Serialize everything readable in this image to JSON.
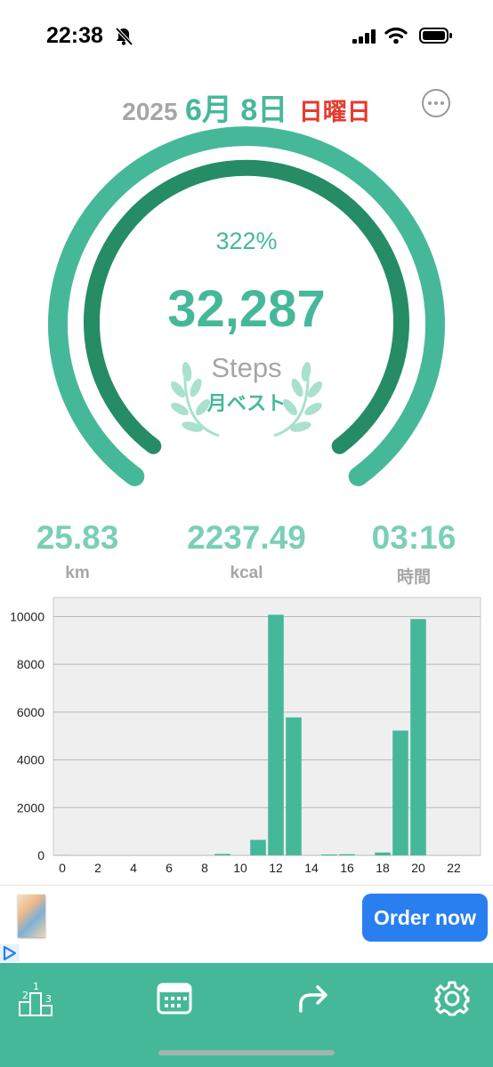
{
  "status_bar": {
    "time": "22:38"
  },
  "date": {
    "year": "2025",
    "month_day": "6月 8日",
    "weekday": "日曜日"
  },
  "gauge": {
    "percent_text": "322%",
    "progress": 3.22,
    "steps": "32,287",
    "steps_label": "Steps",
    "badge": "月ベスト"
  },
  "stats": [
    {
      "value": "25.83",
      "label": "km"
    },
    {
      "value": "2237.49",
      "label": "kcal"
    },
    {
      "value": "03:16",
      "label": "時間"
    }
  ],
  "chart_data": {
    "type": "bar",
    "x": [
      0,
      1,
      2,
      3,
      4,
      5,
      6,
      7,
      8,
      9,
      10,
      11,
      12,
      13,
      14,
      15,
      16,
      17,
      18,
      19,
      20,
      21,
      22,
      23
    ],
    "values": [
      10,
      0,
      0,
      0,
      0,
      0,
      0,
      0,
      0,
      60,
      0,
      650,
      10080,
      5780,
      0,
      40,
      50,
      0,
      120,
      5230,
      9900,
      0,
      0,
      0
    ],
    "x_ticks": [
      "0",
      "2",
      "4",
      "6",
      "8",
      "10",
      "12",
      "14",
      "16",
      "18",
      "20",
      "22"
    ],
    "y_ticks": [
      "0",
      "2000",
      "4000",
      "6000",
      "8000",
      "10000"
    ],
    "ylim": [
      0,
      10800
    ],
    "grid": true,
    "bar_color": "#46b89a"
  },
  "ad": {
    "button_label": "Order now"
  },
  "tabs": [
    {
      "name": "ranking",
      "icon": "ranking-icon"
    },
    {
      "name": "calendar",
      "icon": "calendar-icon"
    },
    {
      "name": "share",
      "icon": "share-icon"
    },
    {
      "name": "settings",
      "icon": "gear-icon"
    }
  ],
  "colors": {
    "accent": "#46b89a",
    "accent_dark": "#258c66",
    "weekday": "#e53b2c",
    "order_button": "#2a7ff0"
  }
}
